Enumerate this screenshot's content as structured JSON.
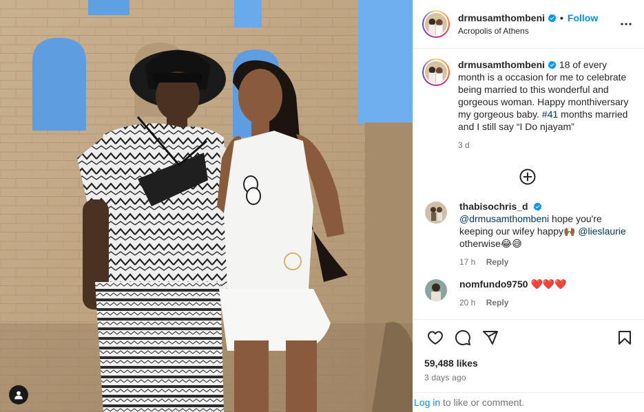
{
  "post": {
    "username": "drmusamthombeni",
    "follow_label": "Follow",
    "location": "Acropolis of Athens",
    "caption_text": "18 of every month is a occasion for me to celebrate being married to this wonderful and gorgeous woman. Happy monthiversary my gorgeous baby. ",
    "caption_hashtag": "#41",
    "caption_tail": " months married and I still say “I Do njayam”",
    "caption_age": "3 d",
    "verified_color": "#0095f6"
  },
  "comments": [
    {
      "username": "thabisochris_d",
      "mention1": "@drmusamthombeni",
      "text1": "hope you're keeping our wifey happy🙌🏾",
      "mention2": "@lieslaurie",
      "text2": " otherwise😂😅",
      "age": "17 h",
      "reply_label": "Reply"
    },
    {
      "username": "nomfundo9750",
      "text": "❤️❤️❤️",
      "age": "20 h",
      "reply_label": "Reply"
    }
  ],
  "footer": {
    "likes": "59,488 likes",
    "date": "3 days ago",
    "login_link": "Log in",
    "login_text": " to like or comment."
  },
  "icons": {
    "like": "heart-icon",
    "comment": "comment-icon",
    "share": "share-icon",
    "save": "bookmark-icon",
    "more": "more-options-icon",
    "load_more": "plus-circle-icon",
    "tagged_user": "user-tag-icon"
  }
}
